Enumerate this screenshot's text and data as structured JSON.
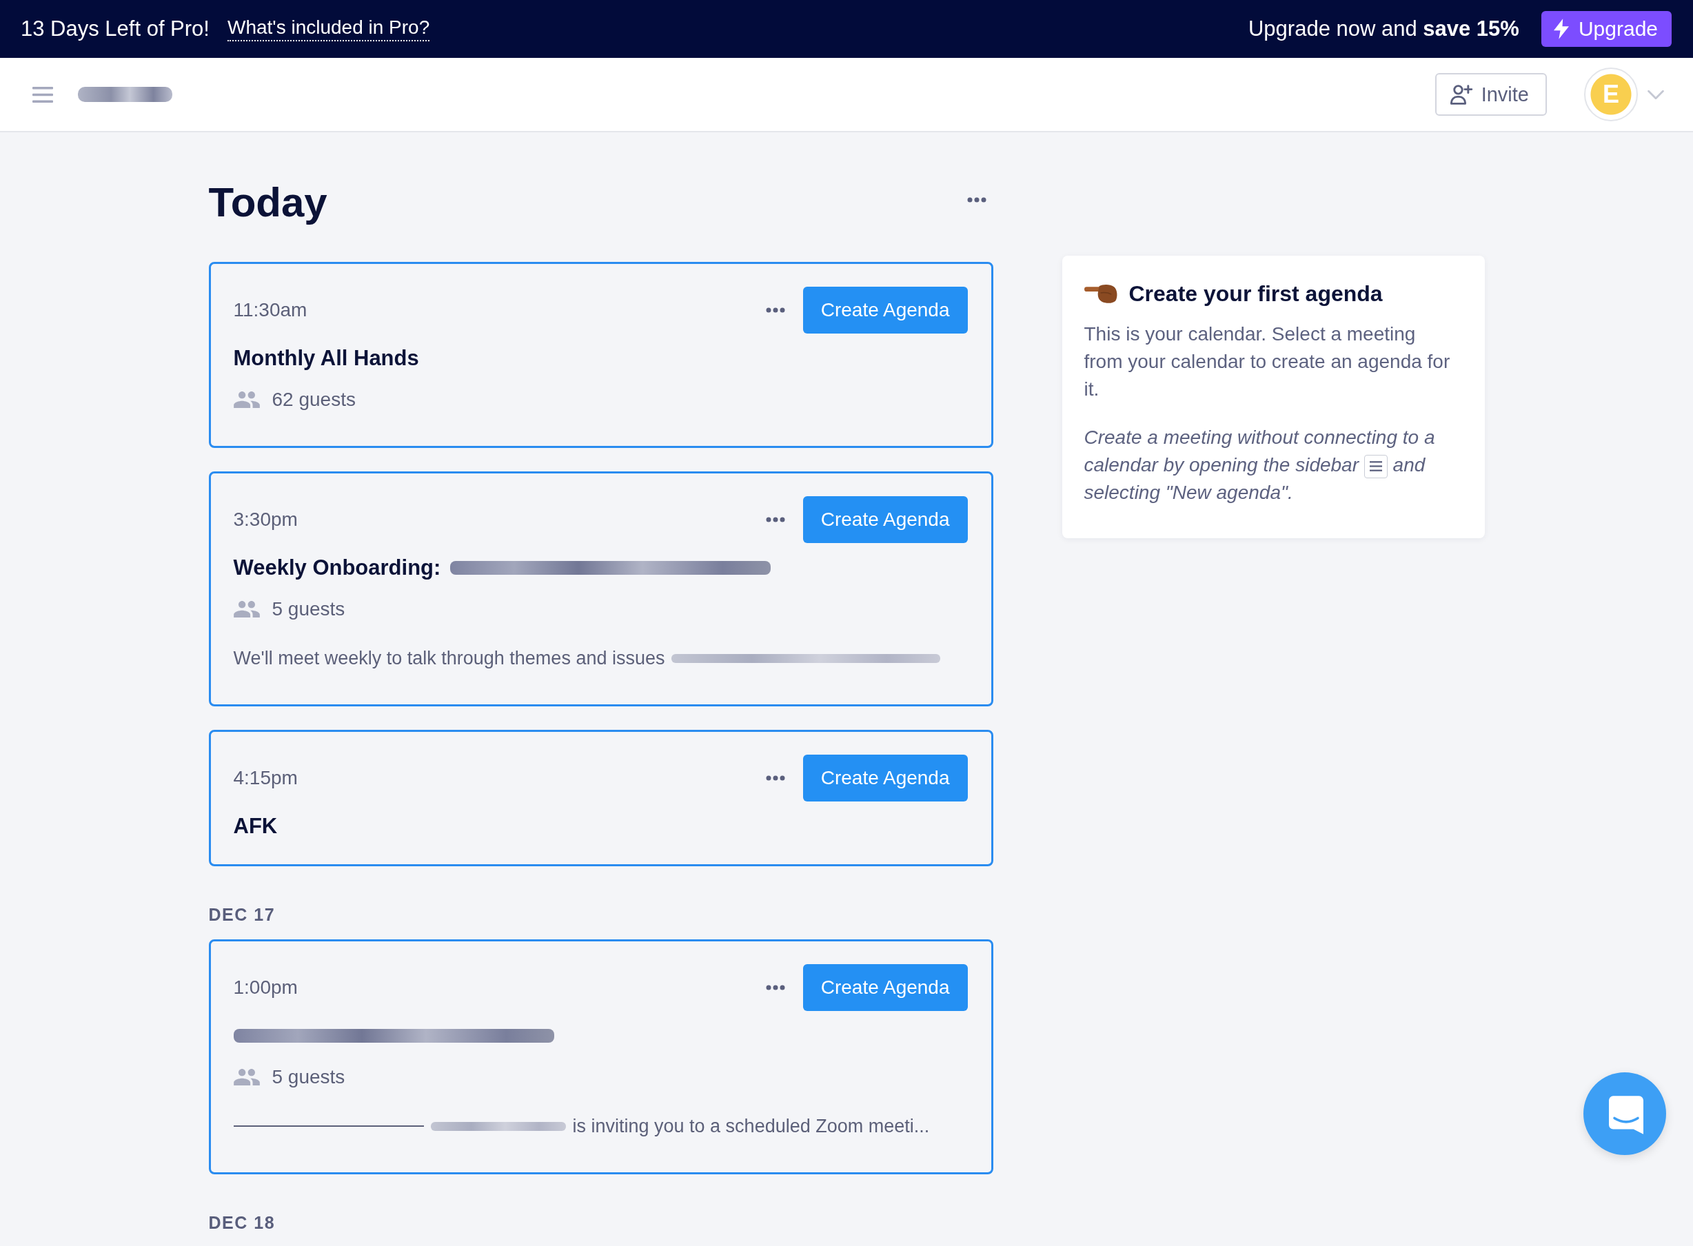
{
  "banner": {
    "trial_text": "13 Days Left of Pro!",
    "link": "What's included in Pro?",
    "promo": "Upgrade now and **save 15%**",
    "upgrade_button": "Upgrade"
  },
  "header": {
    "logo_redacted": true,
    "invite_button": "Invite",
    "avatar_initial": "E"
  },
  "title": "Today",
  "day_groups": [
    {
      "meetings": [
        {
          "time": "11:30am",
          "title": [
            {
              "kind": "text",
              "text": "Monthly All Hands"
            }
          ],
          "guests": "62 guests",
          "action": "Create Agenda"
        },
        {
          "time": "3:30pm",
          "title": [
            {
              "kind": "text",
              "text": "Weekly Onboarding:"
            },
            {
              "kind": "redacted"
            }
          ],
          "guests": "5 guests",
          "description": [
            {
              "kind": "text",
              "text": "We'll meet weekly to talk through themes and issues"
            },
            {
              "kind": "redacted"
            }
          ],
          "action": "Create Agenda"
        },
        {
          "time": "4:15pm",
          "title": [
            {
              "kind": "text",
              "text": "AFK"
            }
          ],
          "action": "Create Agenda"
        }
      ]
    },
    {
      "label": "DEC 17",
      "meetings": [
        {
          "time": "1:00pm",
          "title": [
            {
              "kind": "redacted"
            }
          ],
          "guests": "5 guests",
          "description": [
            {
              "kind": "rule"
            },
            {
              "kind": "redacted"
            },
            {
              "kind": "text",
              "text": "is inviting you to a scheduled Zoom meeti..."
            }
          ],
          "action": "Create Agenda"
        }
      ]
    },
    {
      "label": "DEC 18"
    }
  ],
  "tip": {
    "title": "Create your first agenda",
    "body": "This is your calendar. Select a meeting from your calendar to create an agenda for it.",
    "hint_before": "Create a meeting without connecting to a calendar by opening the sidebar",
    "hint_after": "and selecting \"New agenda\"."
  }
}
